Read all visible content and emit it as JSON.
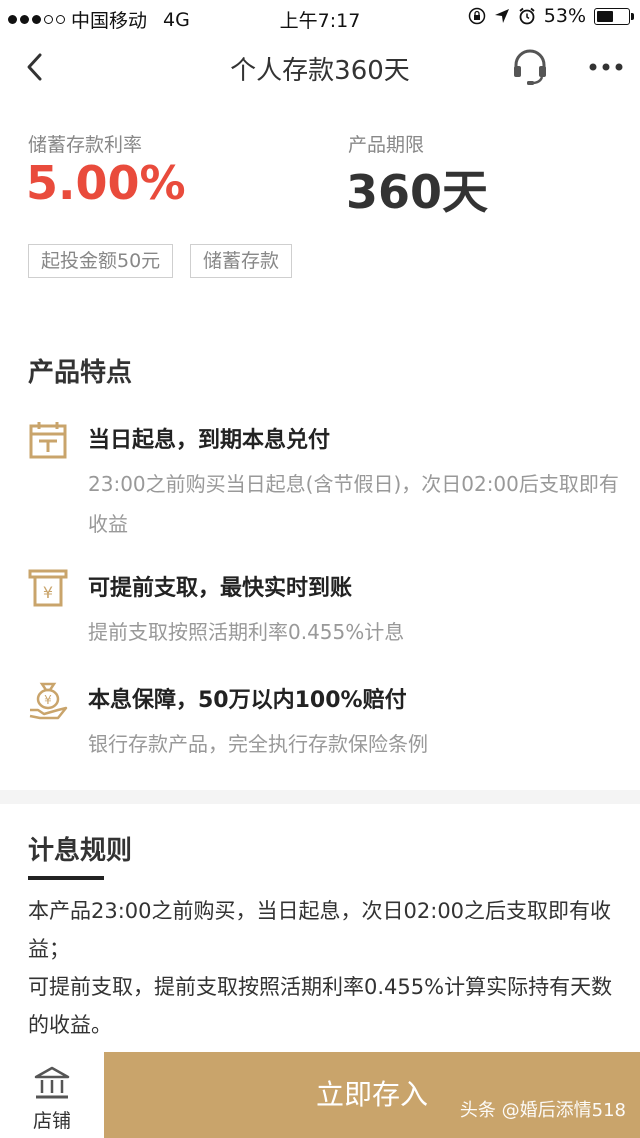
{
  "status_bar": {
    "carrier": "中国移动",
    "network": "4G",
    "time": "上午7:17",
    "battery_percent": "53%",
    "battery_level": 0.53
  },
  "nav": {
    "title": "个人存款360天"
  },
  "header": {
    "rate_label": "储蓄存款利率",
    "rate_value": "5.00%",
    "term_label": "产品期限",
    "term_value": "360天",
    "tags": [
      "起投金额50元",
      "储蓄存款"
    ]
  },
  "features": {
    "title": "产品特点",
    "items": [
      {
        "icon": "calendar-icon",
        "title": "当日起息，到期本息兑付",
        "desc": "23:00之前购买当日起息(含节假日)，次日02:00后支取即有收益"
      },
      {
        "icon": "withdraw-icon",
        "title": "可提前支取，最快实时到账",
        "desc": "提前支取按照活期利率0.455%计息"
      },
      {
        "icon": "money-bag-hand-icon",
        "title": "本息保障，50万以内100%赔付",
        "desc": "银行存款产品，完全执行存款保险条例"
      }
    ]
  },
  "rules": {
    "title": "计息规则",
    "text": "本产品23:00之前购买，当日起息，次日02:00之后支取即有收益；\n可提前支取，提前支取按照活期利率0.455%计算实际持有天数的收益。"
  },
  "bottom": {
    "store_label": "店铺",
    "deposit_label": "立即存入"
  },
  "watermark": "头条 @婚后添情518",
  "colors": {
    "accent_gold": "#c9a46b",
    "rate_red": "#e94b3c"
  }
}
